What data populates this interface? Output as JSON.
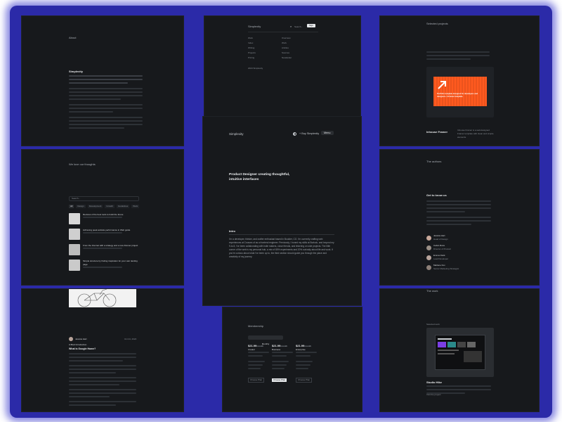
{
  "center": {
    "logo": "Simplexity",
    "buy_label": "Buy Simplexity",
    "menu_label": "Menu",
    "hero": "Product Designer creating thoughtful, intuitive interfaces",
    "intro_title": "Intro",
    "intro_text": "I'm a developer, thinker, and crafter enthusiast based in Boulder, CO. I'm currently crafting web experiences at Crosses of as a frontend engineer. Previously, I honed my skills at Burlock, and beyond my 9-to-5, I've been collaborating with indie makers, close friends, and tinkering on side projects. The little corner of the web is my personal hub, a mix of 80% experiments and 20% curiosity about life and work. If you're curious about what I've been up to, the third section should guide you through the place and creativity of my journey."
  },
  "top_left": {
    "title": "About",
    "heading": "Simplexity"
  },
  "top_middle": {
    "logo": "Simplexity",
    "search_placeholder": "Search...",
    "button": "Sign",
    "col1": [
      "Work",
      "Index",
      "Writing",
      "Projects",
      "Pricing"
    ],
    "col2": [
      "Overview",
      "Work",
      "Articles",
      "Sources",
      "Newsletter"
    ],
    "footer": "2024 Simplexity"
  },
  "top_right": {
    "title": "Selected projects",
    "banner_text": "Portfolio template designed for developers and designers. A Framer template.",
    "project_name": "Inhouse Framer",
    "project_desc": "Inhouse Framer is a well-designed Framer template with clean and simple elements."
  },
  "mid_left": {
    "title": "We love our thoughts",
    "search_placeholder": "Search...",
    "tags": [
      "All",
      "Design",
      "Development",
      "Growth",
      "Guidelines",
      "Work"
    ],
    "posts": [
      "Reviews of the best tools to build the future",
      "Achieving peak website performance in Web guide",
      "From the Internet with a strategy and a new Framer project",
      "Simple structure by finding inspiration for your own landing page"
    ]
  },
  "mid_right": {
    "title": "The authors",
    "subtitle": "Get to know us",
    "people": [
      {
        "name": "Jessica Hart",
        "role": "Head of Design"
      },
      {
        "name": "Calvin Ross",
        "role": "Director of Product"
      },
      {
        "name": "Emma Clark",
        "role": "Lead Developer"
      },
      {
        "name": "Marlene Fox",
        "role": "Senior Marketing Strategist"
      }
    ]
  },
  "bottom_left": {
    "author": "Jessica Hart",
    "date": "Oct 24, 2024",
    "headline": "A Brief Introduction",
    "section": "What is Google Home?"
  },
  "bottom_middle": {
    "title": "Membership",
    "plans": [
      {
        "price": "$21.99",
        "period": "/month",
        "name": "Creator",
        "cta": "Choose Plan"
      },
      {
        "price": "$21.99",
        "period": "/month",
        "name": "Business",
        "cta": "Choose Plan"
      },
      {
        "price": "$21.99",
        "period": "/month",
        "name": "Enterprise",
        "cta": "Choose Plan"
      }
    ],
    "selected": "Monthly"
  },
  "bottom_right": {
    "title": "The work",
    "subtitle": "Selected work",
    "project_name": "Studio Hike",
    "link": "Visit the project"
  },
  "colors": {
    "panel_bg": "#17191c",
    "glow": "#2b2aa8",
    "accent_orange": "#ff5a1f",
    "text": "#d8dadd"
  }
}
